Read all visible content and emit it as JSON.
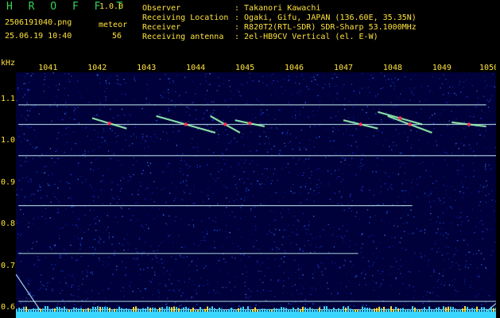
{
  "header": {
    "app_title": "H R O F F T",
    "app_version": "1.0.0",
    "file_name": "2506191040.png",
    "datetime": "25.06.19 10:40",
    "mode_label": "meteor",
    "count_value": "56",
    "rows": [
      {
        "label": "Observer",
        "value": ": Takanori Kawachi"
      },
      {
        "label": "Receiving Location",
        "value": ": Ogaki, Gifu, JAPAN (136.60E, 35.35N)"
      },
      {
        "label": "Receiver",
        "value": ": R820T2(RTL-SDR) SDR-Sharp 53.1000MHz"
      },
      {
        "label": "Receiving antenna",
        "value": ": 2el-HB9CV Vertical (el. E-W)"
      }
    ]
  },
  "colors": {
    "background": "#00003a",
    "text_green": "#39d353",
    "text_yellow": "#ffe23b",
    "trace": "#cfffff",
    "meteor": "#ff3355"
  },
  "chart_data": {
    "type": "heatmap",
    "xlabel": "",
    "ylabel": "kHz",
    "x_ticks": [
      1041,
      1042,
      1043,
      1044,
      1045,
      1046,
      1047,
      1048,
      1049,
      1050
    ],
    "y_ticks": [
      0.6,
      0.7,
      0.8,
      0.9,
      1.0,
      1.1
    ],
    "y_unit": "kHz",
    "xlim": [
      1040.35,
      1050.1
    ],
    "ylim": [
      0.575,
      1.165
    ],
    "carriers": [
      {
        "y": 1.087,
        "x0": 1040.4,
        "x1": 1049.9
      },
      {
        "y": 1.04,
        "x0": 1040.4,
        "x1": 1050.1
      },
      {
        "y": 0.965,
        "x0": 1040.4,
        "x1": 1050.1
      },
      {
        "y": 0.845,
        "x0": 1040.4,
        "x1": 1048.4
      },
      {
        "y": 0.73,
        "x0": 1040.4,
        "x1": 1047.3
      },
      {
        "y": 0.615,
        "x0": 1040.4,
        "x1": 1050.1
      },
      {
        "y": 0.595,
        "x0": 1040.4,
        "x1": 1050.1
      }
    ],
    "meteors": [
      {
        "x0": 1041.9,
        "y0": 1.055,
        "x1": 1042.6,
        "y1": 1.03
      },
      {
        "x0": 1043.2,
        "y0": 1.06,
        "x1": 1044.4,
        "y1": 1.02
      },
      {
        "x0": 1044.3,
        "y0": 1.06,
        "x1": 1044.9,
        "y1": 1.02
      },
      {
        "x0": 1044.8,
        "y0": 1.05,
        "x1": 1045.4,
        "y1": 1.035
      },
      {
        "x0": 1047.0,
        "y0": 1.05,
        "x1": 1047.7,
        "y1": 1.03
      },
      {
        "x0": 1047.7,
        "y0": 1.07,
        "x1": 1048.6,
        "y1": 1.04
      },
      {
        "x0": 1047.9,
        "y0": 1.06,
        "x1": 1048.8,
        "y1": 1.02
      },
      {
        "x0": 1049.2,
        "y0": 1.045,
        "x1": 1049.9,
        "y1": 1.035
      }
    ],
    "diagonals": [
      {
        "x0": 1040.35,
        "y0": 0.68,
        "x1": 1040.95,
        "y1": 0.575
      },
      {
        "x0": 1049.75,
        "y0": 0.575,
        "x1": 1050.1,
        "y1": 0.61
      }
    ]
  }
}
